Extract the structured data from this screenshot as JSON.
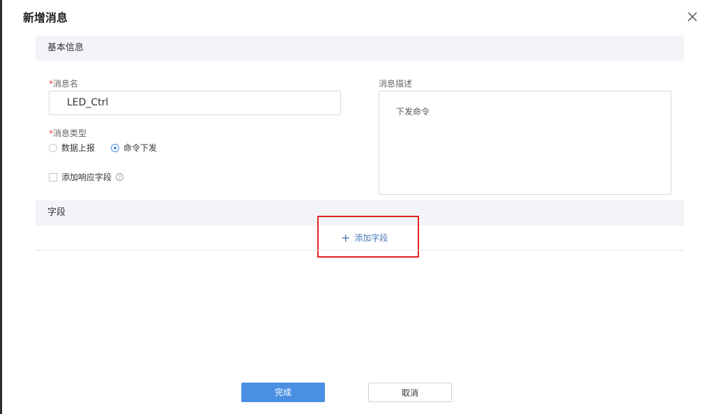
{
  "dialog": {
    "title": "新增消息"
  },
  "basic_info": {
    "section_title": "基本信息",
    "message_name": {
      "required_mark": "*",
      "label": "消息名",
      "value": "LED_Ctrl"
    },
    "message_type": {
      "required_mark": "*",
      "label": "消息类型",
      "options": [
        {
          "label": "数据上报",
          "checked": false
        },
        {
          "label": "命令下发",
          "checked": true
        }
      ]
    },
    "response_field": {
      "label": "添加响应字段",
      "checked": false,
      "help_icon": "question-circle-icon"
    },
    "description": {
      "label": "消息描述",
      "value": "下发命令"
    }
  },
  "fields": {
    "section_title": "字段",
    "add_label": "添加字段",
    "add_icon": "plus-icon"
  },
  "footer": {
    "ok_label": "完成",
    "cancel_label": "取消"
  },
  "colors": {
    "accent": "#4a90e2",
    "required": "#e4393c",
    "highlight": "#e02020",
    "section_bg": "#f2f4f8"
  }
}
